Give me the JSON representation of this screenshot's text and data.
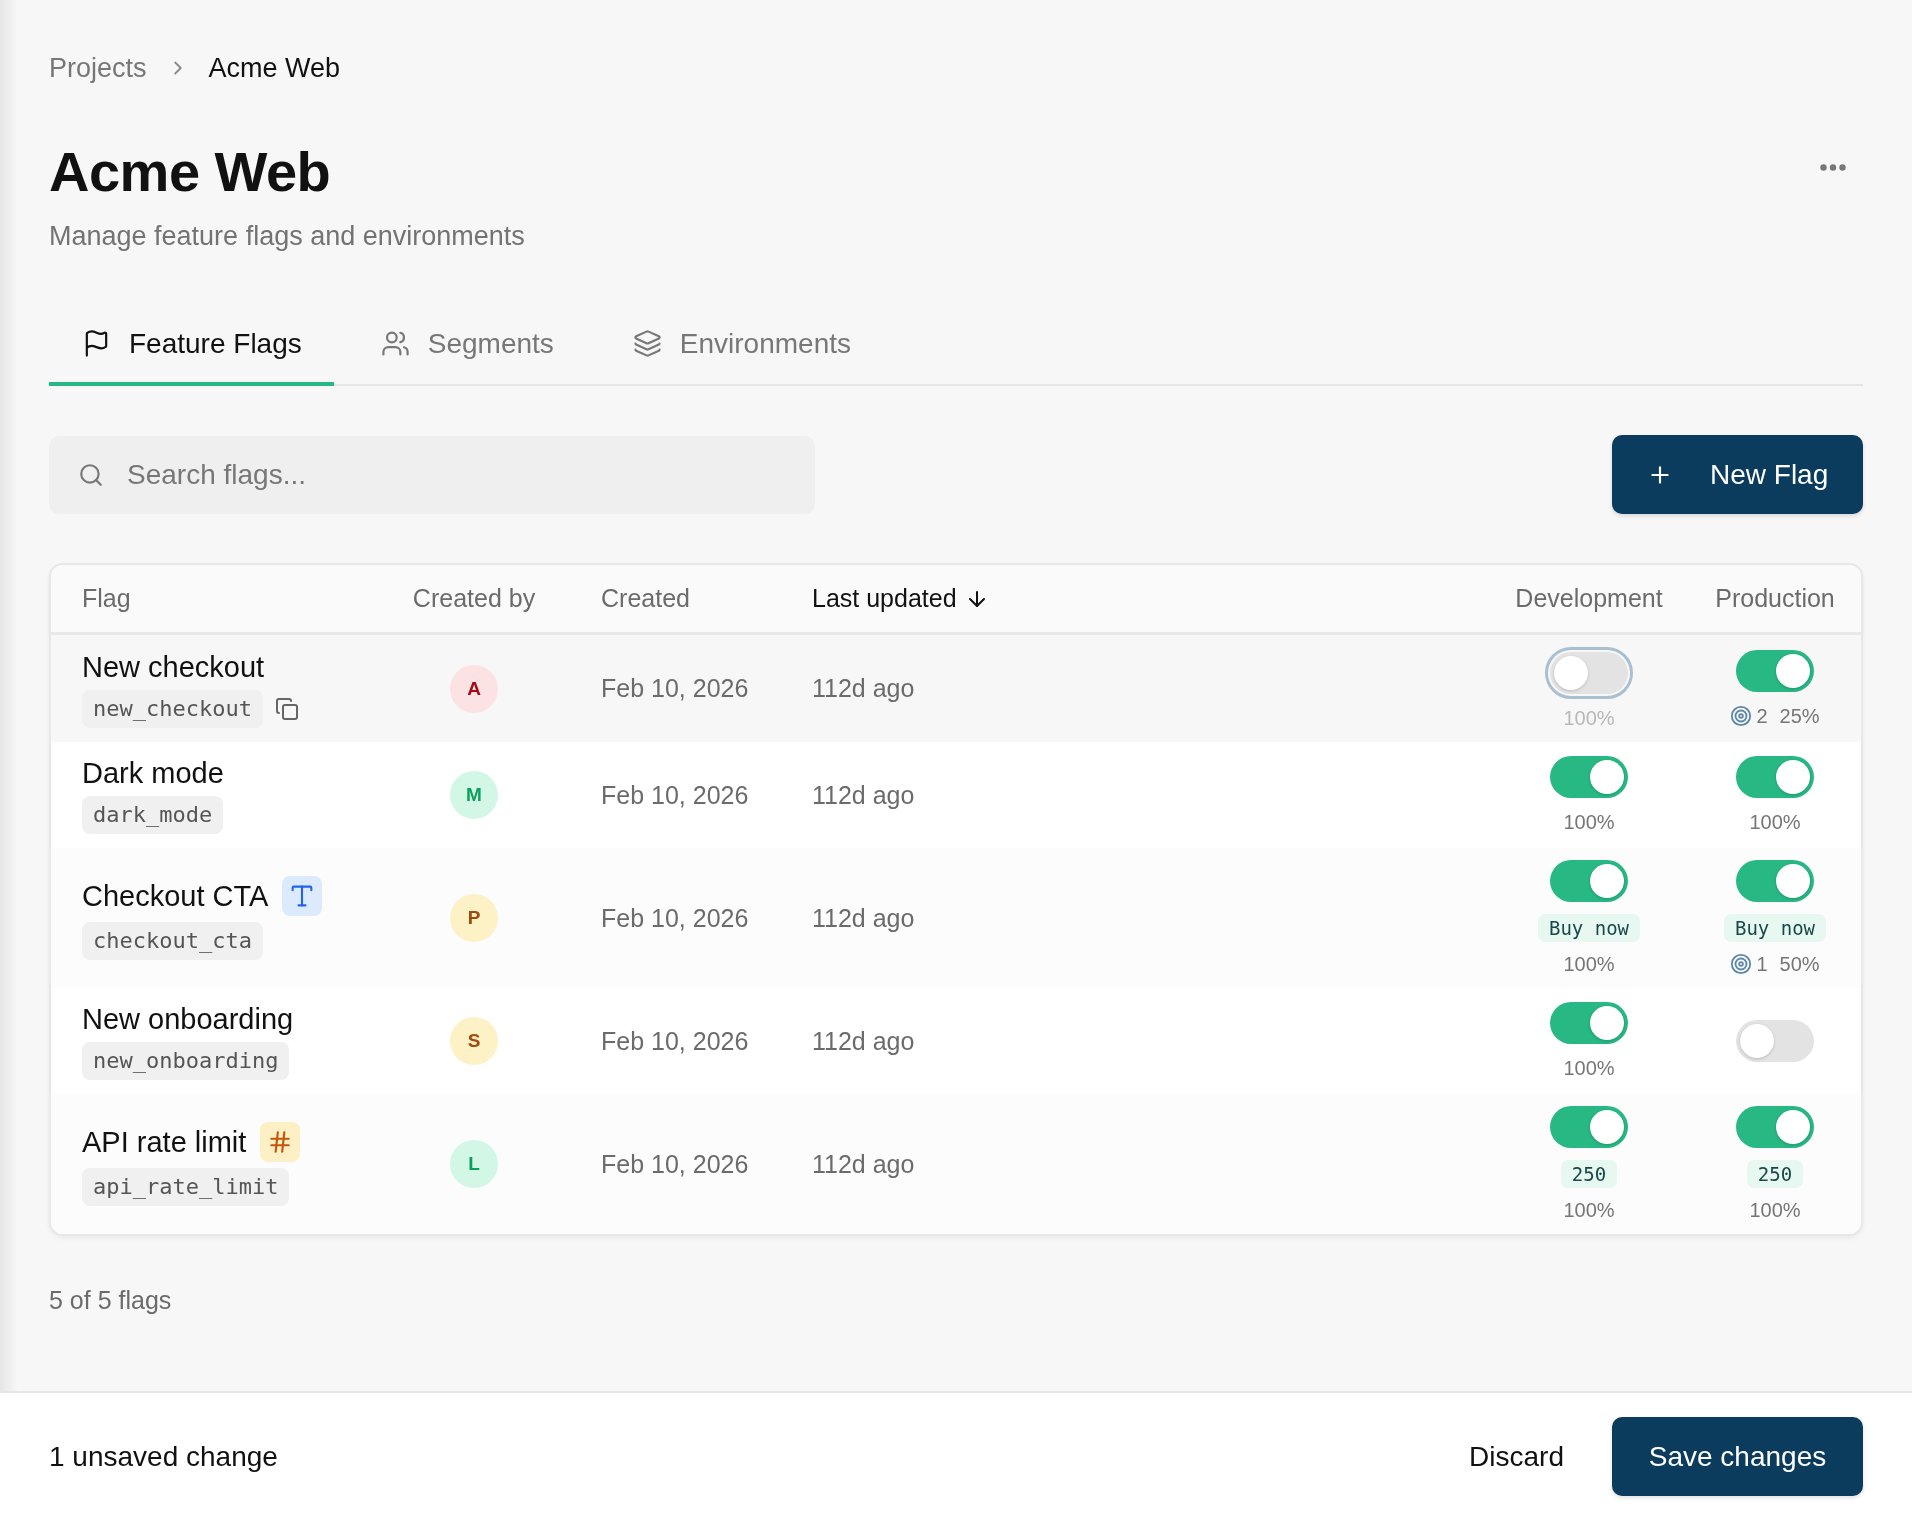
{
  "breadcrumb": [
    {
      "label": "Projects",
      "current": false
    },
    {
      "label": "Acme Web",
      "current": true
    }
  ],
  "header": {
    "title": "Acme Web",
    "subtitle": "Manage feature flags and environments"
  },
  "tabs": [
    {
      "label": "Feature Flags",
      "selected": true
    },
    {
      "label": "Segments",
      "selected": false
    },
    {
      "label": "Environments",
      "selected": false
    }
  ],
  "search": {
    "placeholder": "Search flags..."
  },
  "new_flag_button": {
    "label": "New Flag"
  },
  "table": {
    "columns": [
      {
        "label": "Flag",
        "sorted": false
      },
      {
        "label": "Created by",
        "sorted": false
      },
      {
        "label": "Created",
        "sorted": false
      },
      {
        "label": "Last updated",
        "sorted": true
      },
      {
        "label": "Development",
        "sorted": false
      },
      {
        "label": "Production",
        "sorted": false
      }
    ],
    "rows": [
      {
        "name": "New checkout",
        "key": "new_checkout",
        "kind": "boolean",
        "hovered": true,
        "author": {
          "initial": "A",
          "color": "#fde2e4"
        },
        "created": "Feb 10, 2026",
        "updated": "112d ago",
        "environments": [
          {
            "on": false,
            "focused": true,
            "rollout": "100%"
          },
          {
            "on": true,
            "focused": false,
            "segments": "2",
            "rollout": "25%"
          }
        ]
      },
      {
        "name": "Dark mode",
        "key": "dark_mode",
        "kind": "boolean",
        "hovered": false,
        "author": {
          "initial": "M",
          "color": "#d3f7e6"
        },
        "created": "Feb 10, 2026",
        "updated": "112d ago",
        "environments": [
          {
            "on": true,
            "focused": false,
            "rollout": "100%"
          },
          {
            "on": true,
            "focused": false,
            "rollout": "100%"
          }
        ]
      },
      {
        "name": "Checkout CTA",
        "key": "checkout_cta",
        "kind": "string",
        "hovered": false,
        "author": {
          "initial": "P",
          "color": "#fdf1c6"
        },
        "created": "Feb 10, 2026",
        "updated": "112d ago",
        "environments": [
          {
            "on": true,
            "focused": false,
            "value": "Buy now",
            "rollout": "100%"
          },
          {
            "on": true,
            "focused": false,
            "value": "Buy now",
            "segments": "1",
            "rollout": "50%"
          }
        ]
      },
      {
        "name": "New onboarding",
        "key": "new_onboarding",
        "kind": "boolean",
        "hovered": false,
        "author": {
          "initial": "S",
          "color": "#fdf1c6"
        },
        "created": "Feb 10, 2026",
        "updated": "112d ago",
        "environments": [
          {
            "on": true,
            "focused": false,
            "rollout": "100%"
          },
          {
            "on": false,
            "focused": false
          }
        ]
      },
      {
        "name": "API rate limit",
        "key": "api_rate_limit",
        "kind": "number",
        "hovered": false,
        "author": {
          "initial": "L",
          "color": "#d3f7e6"
        },
        "created": "Feb 10, 2026",
        "updated": "112d ago",
        "environments": [
          {
            "on": true,
            "focused": false,
            "value": "250",
            "rollout": "100%"
          },
          {
            "on": true,
            "focused": false,
            "value": "250",
            "rollout": "100%"
          }
        ]
      }
    ]
  },
  "footer": {
    "count": "5 of 5 flags"
  },
  "save_bar": {
    "status": "1 unsaved change",
    "discard": "Discard",
    "save": "Save changes"
  }
}
